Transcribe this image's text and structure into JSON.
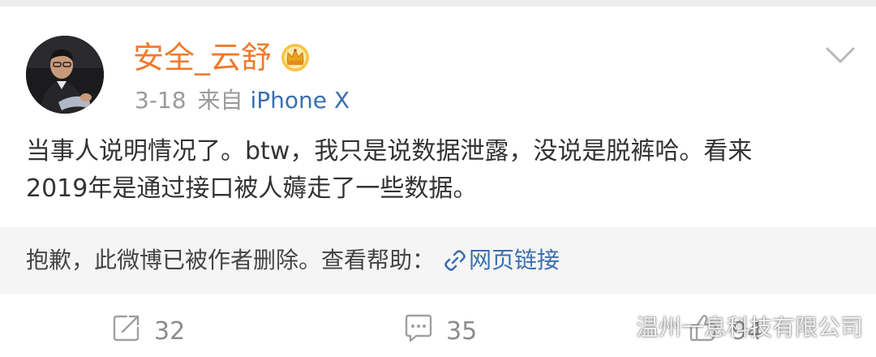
{
  "post": {
    "author": "安全_云舒",
    "date": "3-18",
    "source_prefix": "来自",
    "source_device": "iPhone X",
    "text_line_1": "当事人说明情况了。btw，我只是说数据泄露，没说是脱裤哈。看来",
    "text_line_2": "2019年是通过接口被人薅走了一些数据。"
  },
  "deleted_notice": {
    "message": "抱歉，此微博已被作者删除。查看帮助：",
    "link_label": "网页链接"
  },
  "actions": {
    "repost_count": "32",
    "comment_count": "35",
    "like_count": "94"
  },
  "watermark": {
    "text": "温州一息科技有限公司"
  },
  "icons": {
    "avatar": "avatar",
    "badge": "crown-icon",
    "menu": "chevron-down-icon",
    "link": "link-icon",
    "repost": "repost-icon",
    "comment": "comment-icon",
    "like": "thumbs-up-icon",
    "watermark_logo": "weibo-logo-icon"
  },
  "colors": {
    "username": "#f07a2c",
    "link": "#3b6fb0",
    "meta": "#9a9a9a",
    "deleted_bg": "#f5f5f5"
  }
}
